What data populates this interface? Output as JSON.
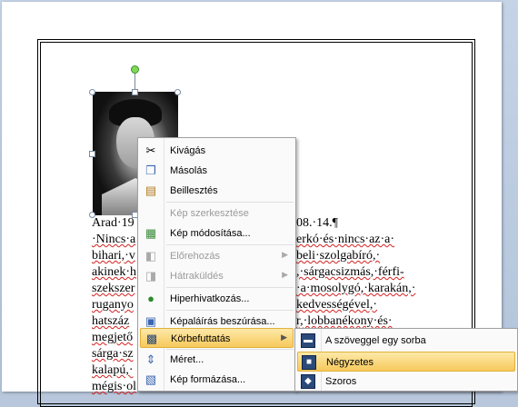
{
  "document": {
    "lines": [
      "Arad·19",
      "·Nincs·a",
      "bihari,·v",
      "akinek·h",
      "szekszer",
      "ruganyo",
      "hatszáz",
      "megjető",
      "sárga·sz",
      "kalapú,·",
      "mégis·ol"
    ],
    "right_fragments": [
      "08.·14.¶",
      "erkó·és·nincs·az·a·",
      "beli·szolgabíró,·",
      ",·sárgacsizmás,·férfi-",
      "·a·mosolygó,·karakán,·",
      "kedvességével,·",
      "r,·lobbanékony·és·"
    ]
  },
  "context_menu": {
    "items": [
      {
        "label": "Kivágás",
        "icon": "scissors-icon",
        "disabled": false
      },
      {
        "label": "Másolás",
        "icon": "copy-icon",
        "disabled": false
      },
      {
        "label": "Beillesztés",
        "icon": "paste-icon",
        "disabled": false
      },
      {
        "label": "Kép szerkesztése",
        "icon": "",
        "disabled": true
      },
      {
        "label": "Kép módosítása...",
        "icon": "change-picture-icon",
        "disabled": false
      },
      {
        "label": "Előrehozás",
        "icon": "bring-forward-icon",
        "disabled": true
      },
      {
        "label": "Hátraküldés",
        "icon": "send-backward-icon",
        "disabled": true
      },
      {
        "label": "Hiperhivatkozás...",
        "icon": "hyperlink-icon",
        "disabled": false
      },
      {
        "label": "Képaláírás beszúrása...",
        "icon": "caption-icon",
        "disabled": false
      },
      {
        "label": "Körbefuttatás",
        "icon": "text-wrap-icon",
        "disabled": false
      },
      {
        "label": "Méret...",
        "icon": "size-icon",
        "disabled": false
      },
      {
        "label": "Kép formázása...",
        "icon": "format-picture-icon",
        "disabled": false
      }
    ]
  },
  "wrap_submenu": {
    "items": [
      {
        "label": "A szöveggel egy sorba",
        "icon": "inline-with-text-icon"
      },
      {
        "label": "Négyzetes",
        "icon": "square-wrap-icon"
      },
      {
        "label": "Szoros",
        "icon": "tight-wrap-icon"
      }
    ]
  },
  "colors": {
    "highlight": "#f7c95c",
    "rotation_handle": "#7ed957",
    "spelling_underline": "#d42020"
  }
}
